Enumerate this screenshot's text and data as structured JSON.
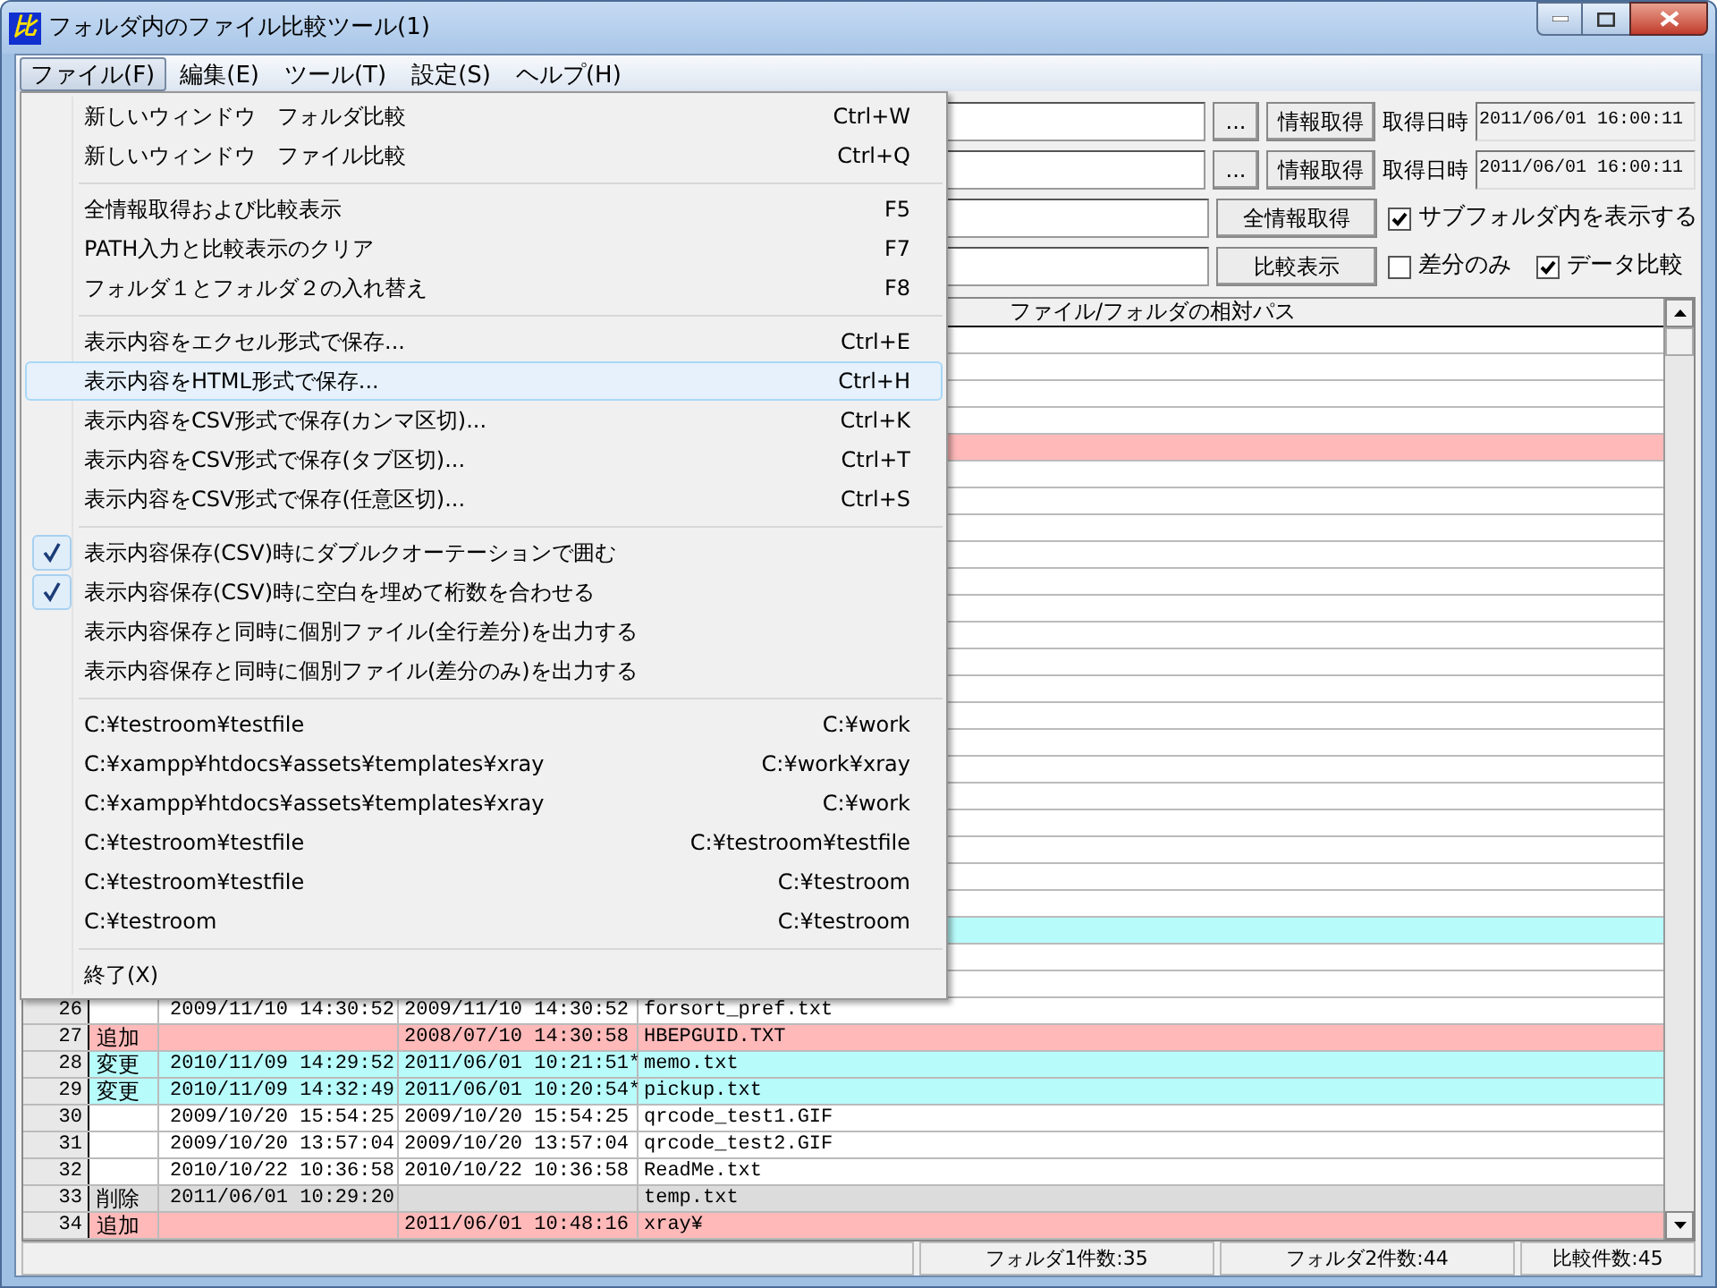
{
  "window": {
    "icon_text": "比",
    "title": "フォルダ内のファイル比較ツール(1)"
  },
  "menubar": [
    {
      "label": "ファイル(F)",
      "selected": true
    },
    {
      "label": "編集(E)",
      "selected": false
    },
    {
      "label": "ツール(T)",
      "selected": false
    },
    {
      "label": "設定(S)",
      "selected": false
    },
    {
      "label": "ヘルプ(H)",
      "selected": false
    }
  ],
  "toolbar": {
    "rows": [
      {
        "kind": "folder",
        "browse": "...",
        "fetch": "情報取得",
        "time_label": "取得日時",
        "time_value": "2011/06/01 16:00:11"
      },
      {
        "kind": "folder",
        "browse": "...",
        "fetch": "情報取得",
        "time_label": "取得日時",
        "time_value": "2011/06/01 16:00:11"
      },
      {
        "kind": "action",
        "button": "全情報取得",
        "options": [
          {
            "label": "サブフォルダ内を表示する",
            "checked": true
          }
        ]
      },
      {
        "kind": "action",
        "button": "比較表示",
        "options": [
          {
            "label": "差分のみ",
            "checked": false
          },
          {
            "label": "データ比較",
            "checked": true
          }
        ]
      }
    ]
  },
  "table": {
    "columns": [
      "ファイル/フォルダの相対パス"
    ],
    "rows": [
      {
        "kind": "same"
      },
      {
        "kind": "same"
      },
      {
        "kind": "same"
      },
      {
        "kind": "same"
      },
      {
        "kind": "added"
      },
      {
        "kind": "same"
      },
      {
        "kind": "same"
      },
      {
        "kind": "same"
      },
      {
        "kind": "same"
      },
      {
        "kind": "same"
      },
      {
        "kind": "same"
      },
      {
        "kind": "same"
      },
      {
        "kind": "same"
      },
      {
        "kind": "same"
      },
      {
        "kind": "same"
      },
      {
        "kind": "same"
      },
      {
        "kind": "same"
      },
      {
        "kind": "same"
      },
      {
        "kind": "same"
      },
      {
        "kind": "same"
      },
      {
        "kind": "same"
      },
      {
        "kind": "same"
      },
      {
        "kind": "changed"
      },
      {
        "kind": "same"
      },
      {
        "kind": "same"
      },
      {
        "kind": "same",
        "number": "26",
        "change": "",
        "time1": "2009/11/10 14:30:52",
        "time2": "2009/11/10 14:30:52",
        "path": "forsort_pref.txt"
      },
      {
        "kind": "added",
        "number": "27",
        "change": "追加",
        "time1": "",
        "time2": "2008/07/10 14:30:58",
        "path": "HBEPGUID.TXT"
      },
      {
        "kind": "changed",
        "number": "28",
        "change": "変更",
        "time1": "2010/11/09 14:29:52",
        "time2": "2011/06/01 10:21:51*",
        "path": "memo.txt"
      },
      {
        "kind": "changed",
        "number": "29",
        "change": "変更",
        "time1": "2010/11/09 14:32:49",
        "time2": "2011/06/01 10:20:54*",
        "path": "pickup.txt"
      },
      {
        "kind": "same",
        "number": "30",
        "change": "",
        "time1": "2009/10/20 15:54:25",
        "time2": "2009/10/20 15:54:25",
        "path": "qrcode_test1.GIF"
      },
      {
        "kind": "same",
        "number": "31",
        "change": "",
        "time1": "2009/10/20 13:57:04",
        "time2": "2009/10/20 13:57:04",
        "path": "qrcode_test2.GIF"
      },
      {
        "kind": "same",
        "number": "32",
        "change": "",
        "time1": "2010/10/22 10:36:58",
        "time2": "2010/10/22 10:36:58",
        "path": "ReadMe.txt"
      },
      {
        "kind": "deleted",
        "number": "33",
        "change": "削除",
        "time1": "2011/06/01 10:29:20",
        "time2": "",
        "path": "temp.txt"
      },
      {
        "kind": "added",
        "number": "34",
        "change": "追加",
        "time1": "",
        "time2": "2011/06/01 10:48:16",
        "path": "xray¥"
      }
    ]
  },
  "status_bar": [
    "フォルダ1件数:35",
    "フォルダ2件数:44",
    "比較件数:45"
  ],
  "file_menu": [
    {
      "kind": "item",
      "label": "新しいウィンドウ　フォルダ比較",
      "shortcut": "Ctrl+W",
      "checked": false,
      "selected": false
    },
    {
      "kind": "item",
      "label": "新しいウィンドウ　ファイル比較",
      "shortcut": "Ctrl+Q",
      "checked": false,
      "selected": false
    },
    {
      "kind": "separator"
    },
    {
      "kind": "item",
      "label": "全情報取得および比較表示",
      "shortcut": "F5",
      "checked": false,
      "selected": false
    },
    {
      "kind": "item",
      "label": "PATH入力と比較表示のクリア",
      "shortcut": "F7",
      "checked": false,
      "selected": false
    },
    {
      "kind": "item",
      "label": "フォルダ１とフォルダ２の入れ替え",
      "shortcut": "F8",
      "checked": false,
      "selected": false
    },
    {
      "kind": "separator"
    },
    {
      "kind": "item",
      "label": "表示内容をエクセル形式で保存...",
      "shortcut": "Ctrl+E",
      "checked": false,
      "selected": false
    },
    {
      "kind": "item",
      "label": "表示内容をHTML形式で保存...",
      "shortcut": "Ctrl+H",
      "checked": false,
      "selected": true
    },
    {
      "kind": "item",
      "label": "表示内容をCSV形式で保存(カンマ区切)...",
      "shortcut": "Ctrl+K",
      "checked": false,
      "selected": false
    },
    {
      "kind": "item",
      "label": "表示内容をCSV形式で保存(タブ区切)...",
      "shortcut": "Ctrl+T",
      "checked": false,
      "selected": false
    },
    {
      "kind": "item",
      "label": "表示内容をCSV形式で保存(任意区切)...",
      "shortcut": "Ctrl+S",
      "checked": false,
      "selected": false
    },
    {
      "kind": "separator"
    },
    {
      "kind": "item",
      "label": "表示内容保存(CSV)時にダブルクオーテーションで囲む",
      "checked": true,
      "selected": false
    },
    {
      "kind": "item",
      "label": "表示内容保存(CSV)時に空白を埋めて桁数を合わせる",
      "checked": true,
      "selected": false
    },
    {
      "kind": "item",
      "label": "表示内容保存と同時に個別ファイル(全行差分)を出力する",
      "checked": false,
      "selected": false
    },
    {
      "kind": "item",
      "label": "表示内容保存と同時に個別ファイル(差分のみ)を出力する",
      "checked": false,
      "selected": false
    },
    {
      "kind": "separator"
    },
    {
      "kind": "item",
      "label": "C:¥testroom¥testfile",
      "shortcut": "C:¥work",
      "checked": false,
      "selected": false
    },
    {
      "kind": "item",
      "label": "C:¥xampp¥htdocs¥assets¥templates¥xray",
      "shortcut": "C:¥work¥xray",
      "checked": false,
      "selected": false
    },
    {
      "kind": "item",
      "label": "C:¥xampp¥htdocs¥assets¥templates¥xray",
      "shortcut": "C:¥work",
      "checked": false,
      "selected": false
    },
    {
      "kind": "item",
      "label": "C:¥testroom¥testfile",
      "shortcut": "C:¥testroom¥testfile",
      "checked": false,
      "selected": false
    },
    {
      "kind": "item",
      "label": "C:¥testroom¥testfile",
      "shortcut": "C:¥testroom",
      "checked": false,
      "selected": false
    },
    {
      "kind": "item",
      "label": "C:¥testroom",
      "shortcut": "C:¥testroom",
      "checked": false,
      "selected": false
    },
    {
      "kind": "separator"
    },
    {
      "kind": "item",
      "label": "終了(X)",
      "checked": false,
      "selected": false
    }
  ]
}
